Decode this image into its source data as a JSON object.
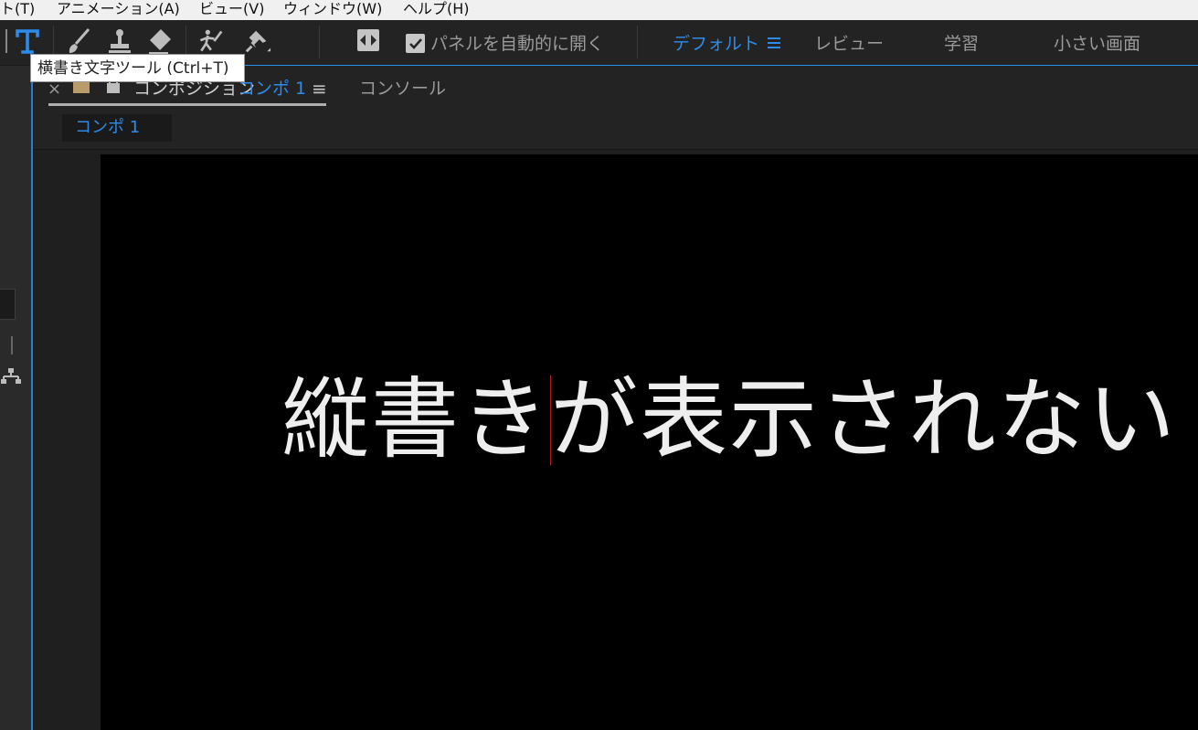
{
  "menu": {
    "items": [
      "ト(T)",
      "アニメーション(A)",
      "ビュー(V)",
      "ウィンドウ(W)",
      "ヘルプ(H)"
    ]
  },
  "toolbar": {
    "tools": [
      {
        "name": "type-tool",
        "icon": "type-t-icon",
        "active": true
      },
      {
        "name": "brush-tool",
        "icon": "brush-icon"
      },
      {
        "name": "clone-stamp-tool",
        "icon": "clone-stamp-icon"
      },
      {
        "name": "eraser-tool",
        "icon": "eraser-icon"
      },
      {
        "name": "roto-brush-tool",
        "icon": "roto-brush-icon"
      },
      {
        "name": "puppet-pin-tool",
        "icon": "pin-icon"
      }
    ],
    "auto_open_label": "パネルを自動的に開く",
    "auto_open_checked": true,
    "workspaces": {
      "default": "デフォルト",
      "review": "レビュー",
      "learn": "学習",
      "small_screen": "小さい画面"
    },
    "accent_color": "#2d8ceb"
  },
  "tooltip": {
    "text": "横書き文字ツール (Ctrl+T)"
  },
  "comp_panel": {
    "close_glyph": "×",
    "title": "コンポジション",
    "comp_name": "コンポ 1",
    "menu_glyph": "≡",
    "console_tab": "コンソール",
    "sub_tab": "コンポ 1"
  },
  "canvas": {
    "text": "縦書きが表示されない",
    "text_color": "#eeeeee",
    "background": "#000000"
  }
}
